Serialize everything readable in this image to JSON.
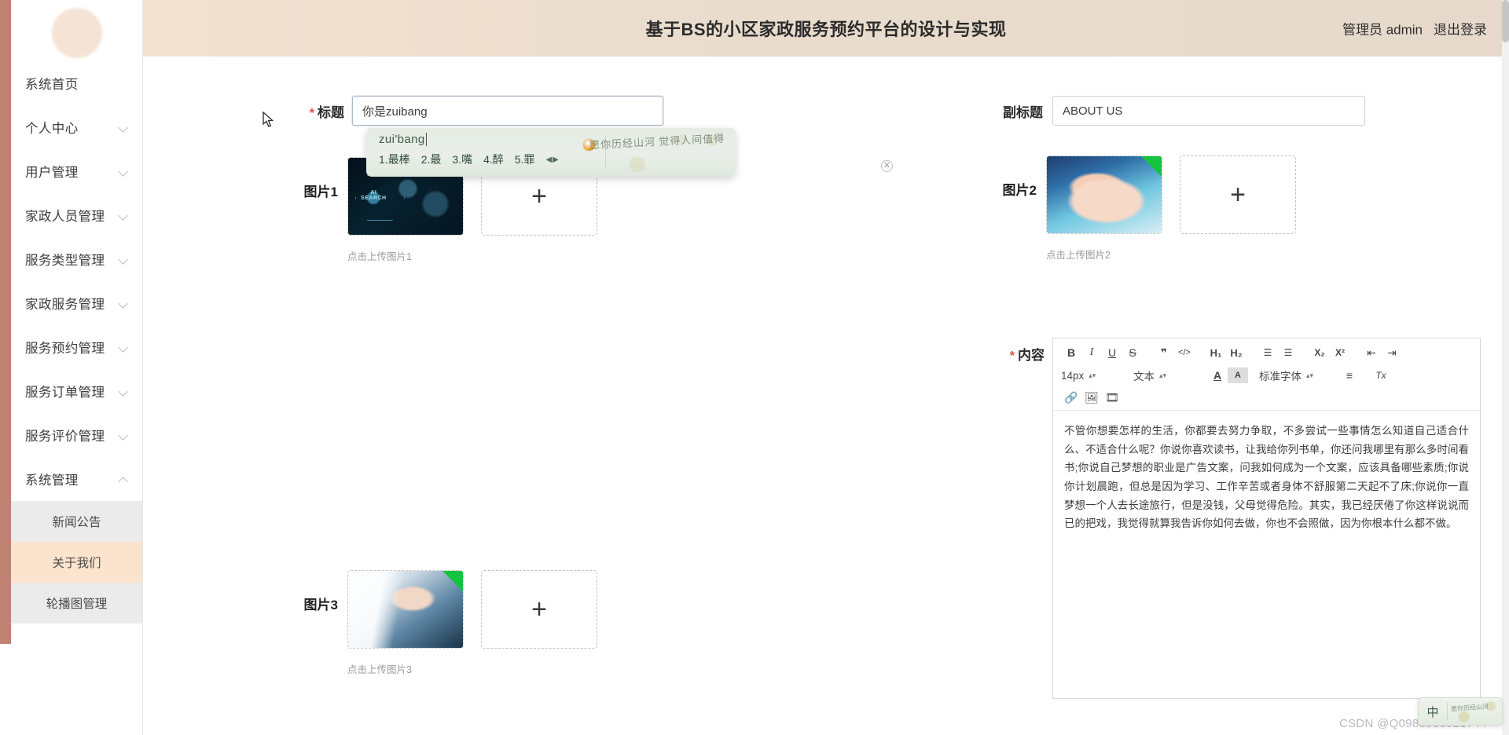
{
  "header": {
    "title": "基于BS的小区家政服务预约平台的设计与实现",
    "role_user": "管理员 admin",
    "logout": "退出登录"
  },
  "sidebar": {
    "items": [
      {
        "label": "系统首页",
        "has_arrow": false,
        "expanded": false
      },
      {
        "label": "个人中心",
        "has_arrow": true,
        "expanded": false
      },
      {
        "label": "用户管理",
        "has_arrow": true,
        "expanded": false
      },
      {
        "label": "家政人员管理",
        "has_arrow": true,
        "expanded": false
      },
      {
        "label": "服务类型管理",
        "has_arrow": true,
        "expanded": false
      },
      {
        "label": "家政服务管理",
        "has_arrow": true,
        "expanded": false
      },
      {
        "label": "服务预约管理",
        "has_arrow": true,
        "expanded": false
      },
      {
        "label": "服务订单管理",
        "has_arrow": true,
        "expanded": false
      },
      {
        "label": "服务评价管理",
        "has_arrow": true,
        "expanded": false
      },
      {
        "label": "系统管理",
        "has_arrow": true,
        "expanded": true
      }
    ],
    "submenu": [
      {
        "label": "新闻公告",
        "active": false
      },
      {
        "label": "关于我们",
        "active": true
      },
      {
        "label": "轮播图管理",
        "active": false
      }
    ]
  },
  "form": {
    "title_label": "标题",
    "title_value": "你是zuibang",
    "title_required": true,
    "subtitle_label": "副标题",
    "subtitle_value": "ABOUT US",
    "image1_label": "图片1",
    "image1_tip": "点击上传图片1",
    "image2_label": "图片2",
    "image2_tip": "点击上传图片2",
    "image3_label": "图片3",
    "image3_tip": "点击上传图片3",
    "plus_glyph": "+",
    "content_label": "内容",
    "content_required": true,
    "content_text": "不管你想要怎样的生活，你都要去努力争取，不多尝试一些事情怎么知道自己适合什么、不适合什么呢？你说你喜欢读书，让我给你列书单，你还问我哪里有那么多时间看书;你说自己梦想的职业是广告文案，问我如何成为一个文案，应该具备哪些素质;你说你计划晨跑，但总是因为学习、工作辛苦或者身体不舒服第二天起不了床;你说你一直梦想一个人去长途旅行，但是没钱，父母觉得危险。其实，我已经厌倦了你这样说说而已的把戏，我觉得就算我告诉你如何去做，你也不会照做，因为你根本什么都不做。"
  },
  "editor": {
    "row1": [
      {
        "name": "bold",
        "glyph": "B"
      },
      {
        "name": "italic",
        "glyph": "I"
      },
      {
        "name": "underline",
        "glyph": "U"
      },
      {
        "name": "strikethrough",
        "glyph": "S"
      },
      {
        "name": "blockquote",
        "glyph": "❞"
      },
      {
        "name": "code",
        "glyph": "</>"
      },
      {
        "name": "heading-1",
        "glyph": "H₁"
      },
      {
        "name": "heading-2",
        "glyph": "H₂"
      },
      {
        "name": "ordered-list",
        "glyph": "☰"
      },
      {
        "name": "bullet-list",
        "glyph": "☰"
      },
      {
        "name": "subscript",
        "glyph": "X₂"
      },
      {
        "name": "superscript",
        "glyph": "X²"
      },
      {
        "name": "outdent",
        "glyph": "⇤"
      },
      {
        "name": "indent",
        "glyph": "⇥"
      }
    ],
    "font_size": "14px",
    "block_type": "文本",
    "font_family": "标准字体",
    "text_color_glyph": "A",
    "highlight_glyph": "A",
    "align_glyph": "≡",
    "clear_format_glyph": "Tx",
    "row3": [
      {
        "name": "link",
        "glyph": "🔗"
      },
      {
        "name": "image",
        "glyph": "🖼"
      },
      {
        "name": "video",
        "glyph": "🎞"
      }
    ]
  },
  "ime": {
    "pinyin": "zui'bang",
    "candidates": [
      "1.最棒",
      "2.最",
      "3.嘴",
      "4.醉",
      "5.罪"
    ],
    "page_arrows": "◀▶",
    "ad_text": "愿你历经山河\n觉得人间值得",
    "status_mode": "中"
  },
  "watermark": "CSDN @Q0985983921744"
}
